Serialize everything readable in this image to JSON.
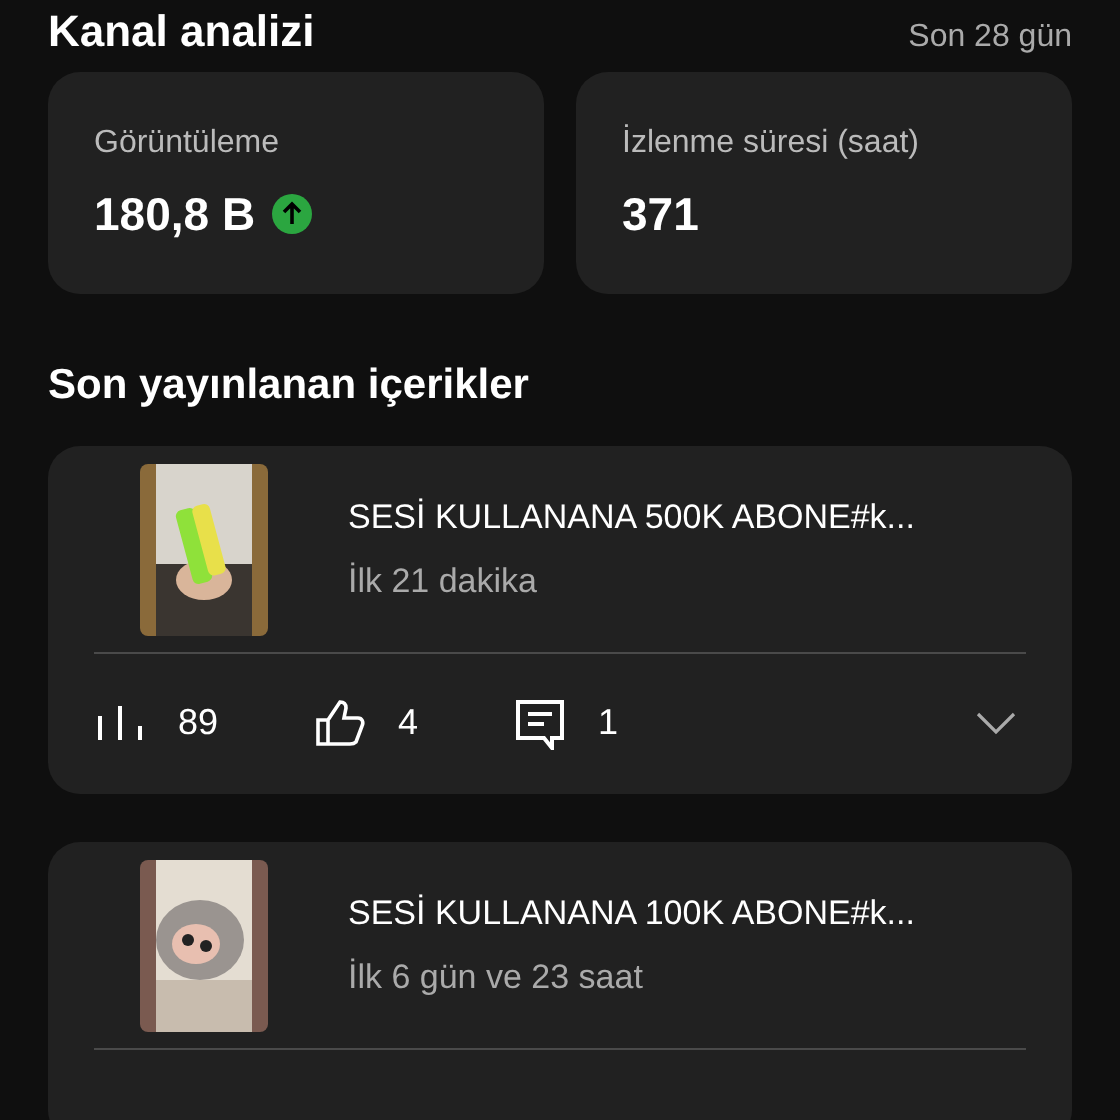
{
  "header": {
    "title": "Kanal analizi",
    "period": "Son 28 gün"
  },
  "metrics": [
    {
      "label": "Görüntüleme",
      "value": "180,8 B",
      "rising": true
    },
    {
      "label": "İzlenme süresi (saat)",
      "value": "371"
    }
  ],
  "section_title": "Son yayınlanan içerikler",
  "videos": [
    {
      "kind": "picture",
      "title": "SESİ KULLANANA 500K ABONE#k...",
      "age": "İlk 21 dakika",
      "stats": {
        "views": "89",
        "likes": "4",
        "comments": "1"
      },
      "expanded": false
    },
    {
      "kind": "picture",
      "title": "SESİ KULLANANA 100K ABONE#k...",
      "age": "İlk 6 gün ve 23 saat"
    }
  ]
}
